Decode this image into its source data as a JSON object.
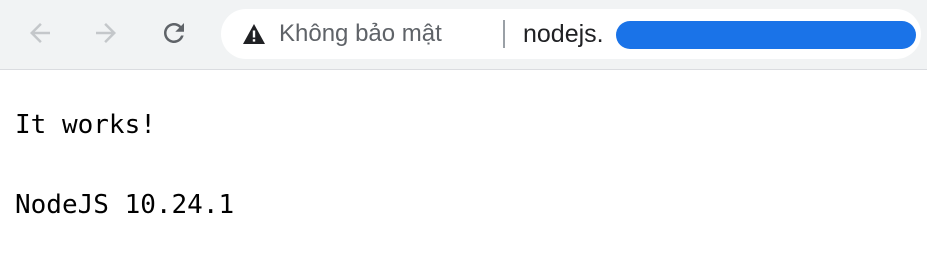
{
  "browser": {
    "nav": {
      "back_icon": "arrow-left-icon",
      "forward_icon": "arrow-right-icon",
      "reload_icon": "reload-icon"
    },
    "address_bar": {
      "security_icon": "warning-triangle-icon",
      "security_label": "Không bảo mật",
      "url_visible": "nodejs.",
      "redaction_color": "#1a73e8"
    }
  },
  "page": {
    "lines": [
      "It works!",
      "NodeJS 10.24.1"
    ]
  }
}
